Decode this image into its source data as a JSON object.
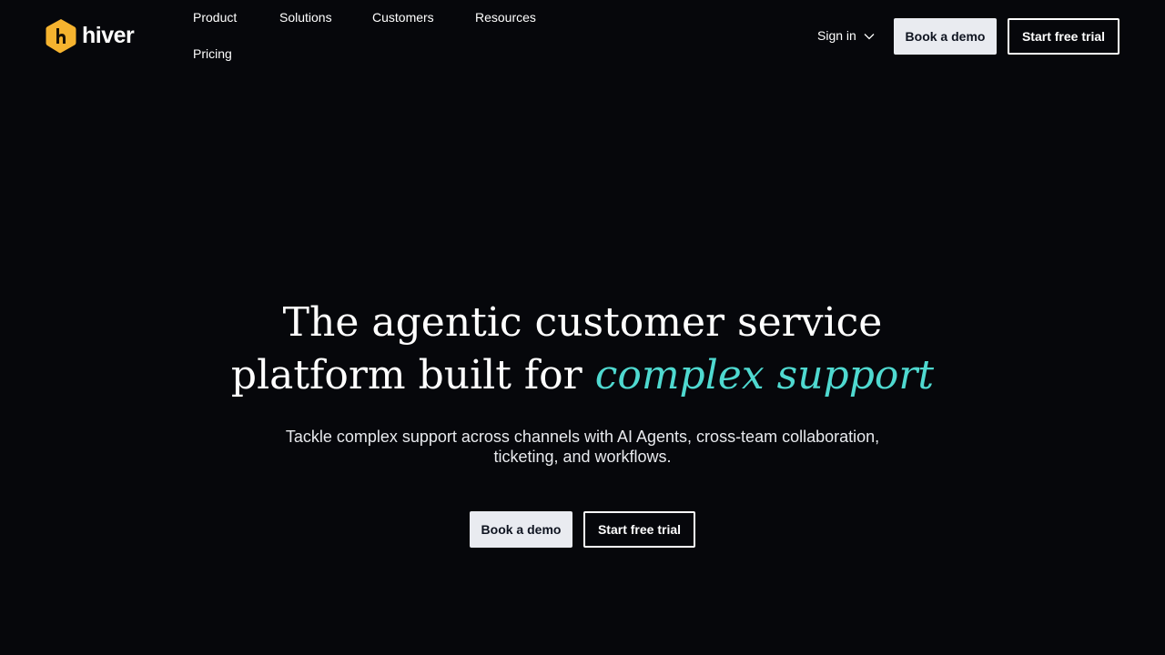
{
  "brand": {
    "name": "hiver",
    "logo_color": "#f5b32f"
  },
  "nav": {
    "items": [
      {
        "label": "Product"
      },
      {
        "label": "Solutions"
      },
      {
        "label": "Customers"
      },
      {
        "label": "Resources"
      },
      {
        "label": "Pricing"
      }
    ]
  },
  "header": {
    "signin_label": "Sign in",
    "book_demo_label": "Book a demo",
    "start_trial_label": "Start free trial"
  },
  "hero": {
    "title_line1": "The agentic customer service",
    "title_line2_plain": "platform built for ",
    "title_line2_accent": "complex support",
    "subtitle_line1": "Tackle complex support across channels with AI Agents, cross-team collaboration,",
    "subtitle_line2": "ticketing, and workflows.",
    "book_demo_label": "Book a demo",
    "start_trial_label": "Start free trial",
    "accent_color": "#4fd9d0"
  },
  "colors": {
    "background": "#06070b",
    "light_button": "#e9ebf0"
  },
  "icons": {
    "signin_chevron": "chevron-down-icon"
  }
}
